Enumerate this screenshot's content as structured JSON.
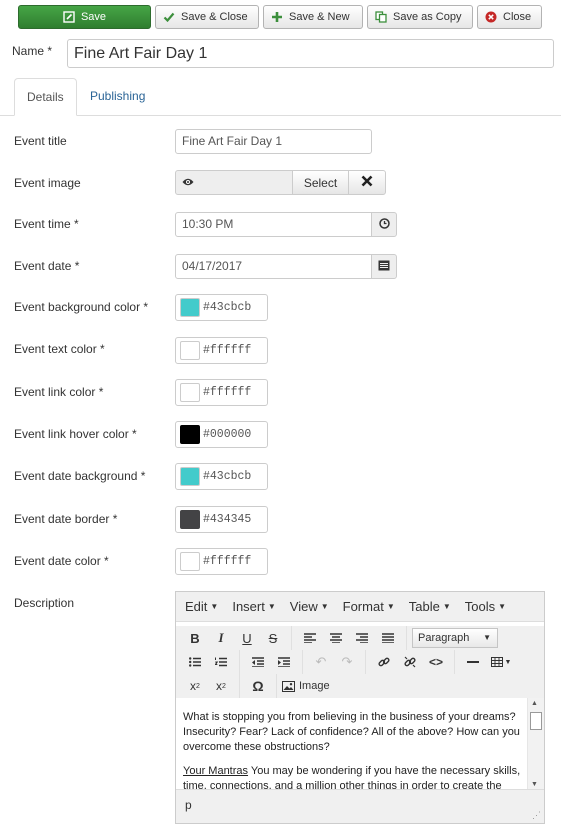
{
  "toolbar": {
    "save": "Save",
    "save_close": "Save & Close",
    "save_new": "Save & New",
    "save_copy": "Save as Copy",
    "close": "Close"
  },
  "name": {
    "label": "Name *",
    "value": "Fine Art Fair Day 1"
  },
  "tabs": [
    {
      "label": "Details"
    },
    {
      "label": "Publishing"
    }
  ],
  "fields": {
    "event_title": {
      "label": "Event title",
      "value": "Fine Art Fair Day 1"
    },
    "event_image": {
      "label": "Event image",
      "select": "Select"
    },
    "event_time": {
      "label": "Event time *",
      "value": "10:30 PM"
    },
    "event_date": {
      "label": "Event date *",
      "value": "04/17/2017"
    },
    "bg_color": {
      "label": "Event background color *",
      "value": "#43cbcb"
    },
    "text_color": {
      "label": "Event text color *",
      "value": "#ffffff"
    },
    "link_color": {
      "label": "Event link color *",
      "value": "#ffffff"
    },
    "link_hover": {
      "label": "Event link hover color *",
      "value": "#000000"
    },
    "date_bg": {
      "label": "Event date background *",
      "value": "#43cbcb"
    },
    "date_border": {
      "label": "Event date border *",
      "value": "#434345"
    },
    "date_color": {
      "label": "Event date color *",
      "value": "#ffffff"
    },
    "description": {
      "label": "Description"
    }
  },
  "editor": {
    "menus": [
      "Edit",
      "Insert",
      "View",
      "Format",
      "Table",
      "Tools"
    ],
    "format_select": "Paragraph",
    "image_button": "Image",
    "content_p1": "What is stopping you from believing in the business of your dreams? Insecurity? Fear? Lack of confidence? All of the above? How can you overcome these obstructions?",
    "content_p2_link": "Your Mantras",
    "content_p2_rest": " You may be wondering if you have the necessary skills, time, connections, and a million other things in order to create the",
    "status_path": "p"
  }
}
